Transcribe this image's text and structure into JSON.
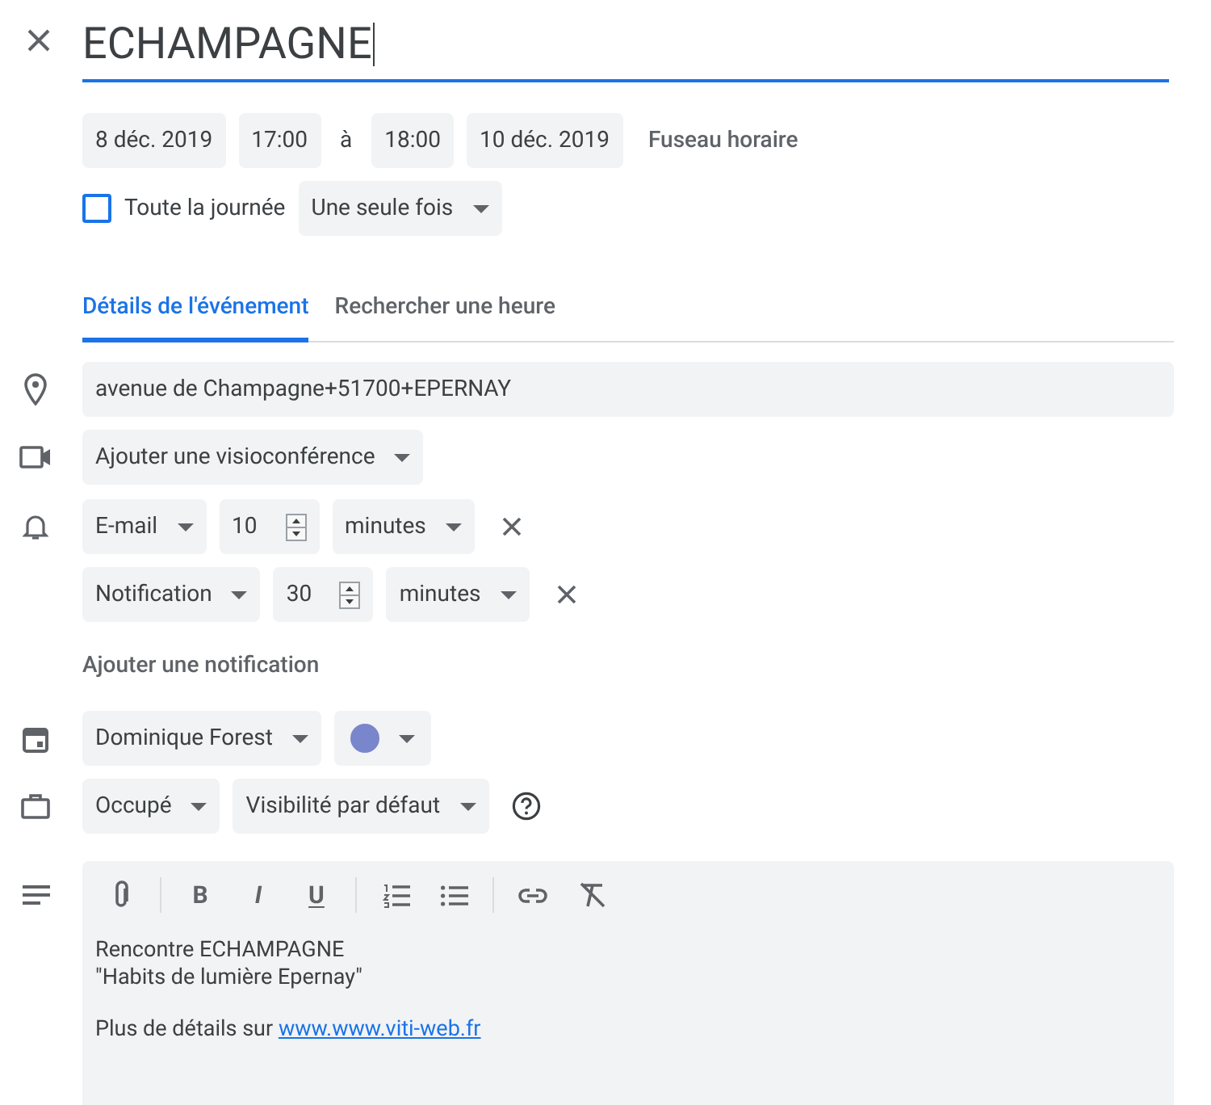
{
  "title": {
    "value": "ECHAMPAGNE"
  },
  "date_row": {
    "start_date": "8 déc. 2019",
    "start_time": "17:00",
    "separator": "à",
    "end_time": "18:00",
    "end_date": "10 déc. 2019",
    "timezone_link": "Fuseau horaire"
  },
  "all_day": {
    "label": "Toute la journée",
    "checked": false
  },
  "recurrence": "Une seule fois",
  "tabs": [
    {
      "label": "Détails de l'événement",
      "selected": true
    },
    {
      "label": "Rechercher une heure",
      "selected": false
    }
  ],
  "location": {
    "value": "avenue de Champagne+51700+EPERNAY"
  },
  "conference": "Ajouter une visioconférence",
  "notifications": [
    {
      "method": "E-mail",
      "amount": "10",
      "unit": "minutes"
    },
    {
      "method": "Notification",
      "amount": "30",
      "unit": "minutes"
    }
  ],
  "add_notification": "Ajouter une notification",
  "calendar": {
    "owner": "Dominique Forest",
    "color": "#7986cb"
  },
  "availability": "Occupé",
  "visibility": "Visibilité par défaut",
  "toolbar": [
    {
      "kind": "attach"
    },
    {
      "kind": "divider"
    },
    {
      "kind": "bold",
      "label": "B"
    },
    {
      "kind": "italic",
      "label": "I"
    },
    {
      "kind": "underline",
      "label": "U"
    },
    {
      "kind": "divider"
    },
    {
      "kind": "numbered"
    },
    {
      "kind": "bulleted"
    },
    {
      "kind": "divider"
    },
    {
      "kind": "link"
    },
    {
      "kind": "clear"
    }
  ],
  "description": {
    "lines": [
      "Rencontre ECHAMPAGNE",
      "\"Habits de lumière Epernay\""
    ],
    "link_prefix": "Plus de détails sur",
    "link": "www.www.viti-web.fr"
  }
}
